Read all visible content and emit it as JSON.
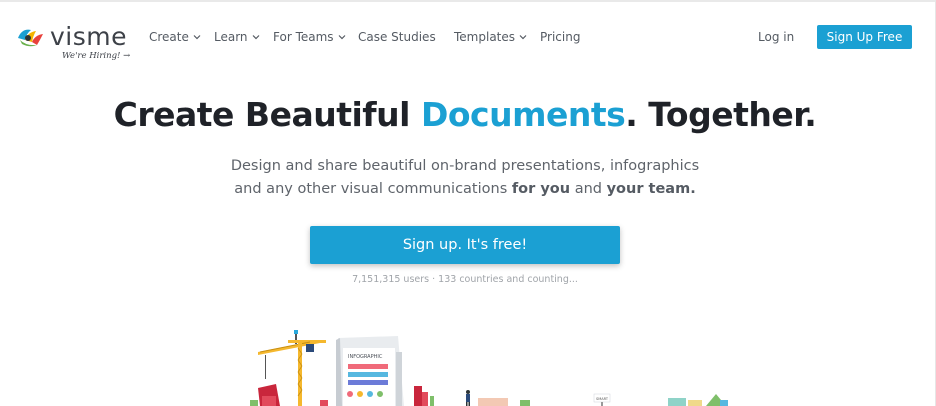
{
  "brand": {
    "name": "visme",
    "tagline": "We're Hiring! →",
    "accent_color": "#1ba0d3"
  },
  "nav": {
    "items": [
      {
        "label": "Create",
        "has_dropdown": true
      },
      {
        "label": "Learn",
        "has_dropdown": true
      },
      {
        "label": "For Teams",
        "has_dropdown": true
      },
      {
        "label": "Case Studies",
        "has_dropdown": false
      },
      {
        "label": "Templates",
        "has_dropdown": true
      },
      {
        "label": "Pricing",
        "has_dropdown": false
      }
    ],
    "login_label": "Log in",
    "signup_label": "Sign Up Free"
  },
  "hero": {
    "headline_pre": "Create Beautiful ",
    "headline_accent": "Documents",
    "headline_post": ". Together.",
    "subtitle_line1": "Design and share beautiful on-brand presentations, infographics",
    "subtitle_line2_pre": "and any other visual communications ",
    "subtitle_line2_bold1": "for you",
    "subtitle_line2_mid": " and ",
    "subtitle_line2_bold2": "your team.",
    "cta_label": "Sign up. It's free!",
    "stats": "7,151,315 users · 133 countries and counting..."
  },
  "illustration": {
    "card_title": "INFOGRAPHIC",
    "sign_text": "SMART"
  }
}
